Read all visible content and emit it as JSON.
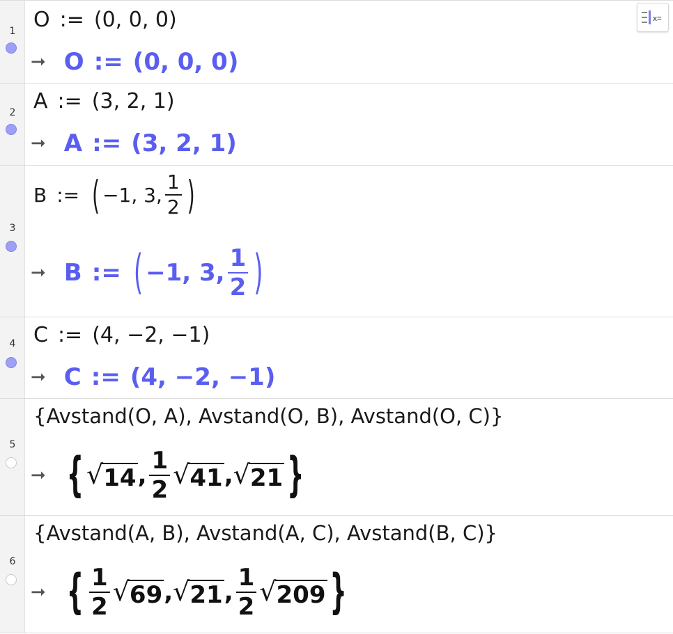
{
  "rows": [
    {
      "num": "1",
      "input_label": "O",
      "input_assign": ":=",
      "input_value": "(0, 0, 0)",
      "output_arrow": "➞",
      "output_label": "O",
      "output_assign": ":=",
      "output_value": "(0, 0, 0)",
      "dot": "filled"
    },
    {
      "num": "2",
      "input_label": "A",
      "input_assign": ":=",
      "input_value": "(3, 2, 1)",
      "output_arrow": "➞",
      "output_label": "A",
      "output_assign": ":=",
      "output_value": "(3, 2, 1)",
      "dot": "filled"
    },
    {
      "num": "3",
      "input_label": "B",
      "input_assign": ":=",
      "input_before": "−1, 3,",
      "input_num": "1",
      "input_den": "2",
      "output_arrow": "➞",
      "output_label": "B",
      "output_assign": ":=",
      "output_before": "−1, 3,",
      "output_num": "1",
      "output_den": "2",
      "dot": "filled"
    },
    {
      "num": "4",
      "input_label": "C",
      "input_assign": ":=",
      "input_value": "(4, −2, −1)",
      "output_arrow": "➞",
      "output_label": "C",
      "output_assign": ":=",
      "output_value": "(4, −2, −1)",
      "dot": "filled"
    },
    {
      "num": "5",
      "input_text": "{Avstand(O, A), Avstand(O, B), Avstand(O, C)}",
      "output_arrow": "➞",
      "r1": "14",
      "frac_num": "1",
      "frac_den": "2",
      "r2": "41",
      "r3": "21",
      "dot": "empty"
    },
    {
      "num": "6",
      "input_text": "{Avstand(A, B), Avstand(A, C), Avstand(B, C)}",
      "output_arrow": "➞",
      "f1_num": "1",
      "f1_den": "2",
      "r1": "69",
      "r2": "21",
      "f2_num": "1",
      "f2_den": "2",
      "r3": "209",
      "dot": "empty"
    }
  ],
  "toolbar": {
    "toggle_icon": "algebra-toggle-icon",
    "toggle_text": "x="
  },
  "colors": {
    "accent": "#5a5ef0",
    "dot": "#9da0f4",
    "gutter": "#f3f3f3"
  }
}
